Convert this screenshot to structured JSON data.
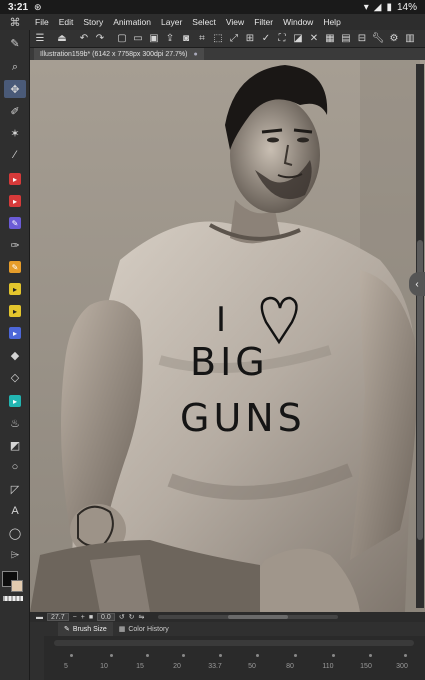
{
  "status": {
    "time": "3:21",
    "battery": "14%"
  },
  "menu": [
    "File",
    "Edit",
    "Story",
    "Animation",
    "Layer",
    "Select",
    "View",
    "Filter",
    "Window",
    "Help"
  ],
  "document": {
    "tab_title": "Illustration159b* (6142 x 7758px 300dpi 27.7%)"
  },
  "artwork": {
    "shirt_lines": [
      "I",
      "BIG",
      "GUNS"
    ]
  },
  "navigator": {
    "zoom": "27.7",
    "angle": "0.0"
  },
  "panel": {
    "tabs": [
      "Brush Size",
      "Color History"
    ],
    "sizes": [
      "5",
      "10",
      "15",
      "20",
      "33.7",
      "50",
      "80",
      "110",
      "150",
      "300"
    ]
  },
  "colors": {
    "main": "#0d0d0d",
    "sub": "#e2cbb0",
    "accent": "#4a5a78"
  }
}
